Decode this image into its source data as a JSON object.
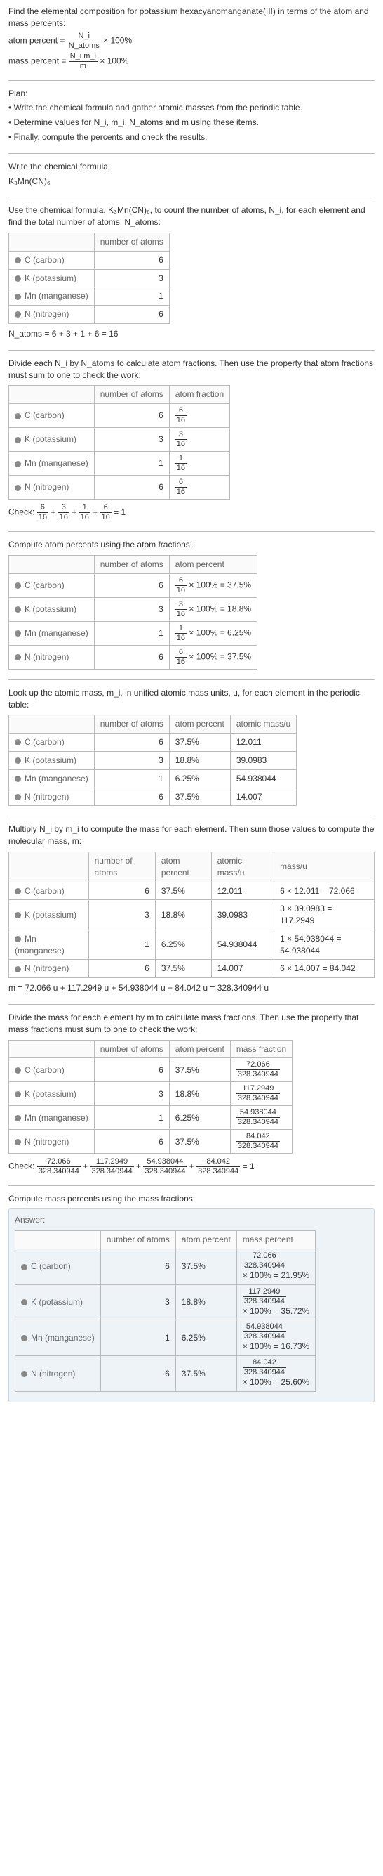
{
  "intro": {
    "line1": "Find the elemental composition for potassium hexacyanomanganate(III) in terms of the atom and mass percents:",
    "atom_percent_label": "atom percent =",
    "atom_percent_frac_num": "N_i",
    "atom_percent_frac_den": "N_atoms",
    "times100": "× 100%",
    "mass_percent_label": "mass percent =",
    "mass_percent_frac_num": "N_i m_i",
    "mass_percent_frac_den": "m"
  },
  "plan": {
    "title": "Plan:",
    "b1": "• Write the chemical formula and gather atomic masses from the periodic table.",
    "b2": "• Determine values for N_i, m_i, N_atoms and m using these items.",
    "b3": "• Finally, compute the percents and check the results."
  },
  "formula_section": {
    "title": "Write the chemical formula:",
    "formula": "K₃Mn(CN)₆"
  },
  "count_section": {
    "text": "Use the chemical formula, K₃Mn(CN)₆, to count the number of atoms, N_i, for each element and find the total number of atoms, N_atoms:",
    "headers": [
      "",
      "number of atoms"
    ],
    "rows": [
      {
        "elem": "C (carbon)",
        "n": "6"
      },
      {
        "elem": "K (potassium)",
        "n": "3"
      },
      {
        "elem": "Mn (manganese)",
        "n": "1"
      },
      {
        "elem": "N (nitrogen)",
        "n": "6"
      }
    ],
    "natoms": "N_atoms = 6 + 3 + 1 + 6 = 16"
  },
  "atomfrac_section": {
    "text": "Divide each N_i by N_atoms to calculate atom fractions. Then use the property that atom fractions must sum to one to check the work:",
    "headers": [
      "",
      "number of atoms",
      "atom fraction"
    ],
    "rows": [
      {
        "elem": "C (carbon)",
        "n": "6",
        "frac_num": "6",
        "frac_den": "16"
      },
      {
        "elem": "K (potassium)",
        "n": "3",
        "frac_num": "3",
        "frac_den": "16"
      },
      {
        "elem": "Mn (manganese)",
        "n": "1",
        "frac_num": "1",
        "frac_den": "16"
      },
      {
        "elem": "N (nitrogen)",
        "n": "6",
        "frac_num": "6",
        "frac_den": "16"
      }
    ],
    "check_label": "Check:",
    "check_expr": "6/16 + 3/16 + 1/16 + 6/16 = 1"
  },
  "atompct_section": {
    "text": "Compute atom percents using the atom fractions:",
    "headers": [
      "",
      "number of atoms",
      "atom percent"
    ],
    "rows": [
      {
        "elem": "C (carbon)",
        "n": "6",
        "frac_num": "6",
        "frac_den": "16",
        "pct": "= 37.5%"
      },
      {
        "elem": "K (potassium)",
        "n": "3",
        "frac_num": "3",
        "frac_den": "16",
        "pct": "= 18.8%"
      },
      {
        "elem": "Mn (manganese)",
        "n": "1",
        "frac_num": "1",
        "frac_den": "16",
        "pct": "= 6.25%"
      },
      {
        "elem": "N (nitrogen)",
        "n": "6",
        "frac_num": "6",
        "frac_den": "16",
        "pct": "= 37.5%"
      }
    ]
  },
  "atomicmass_section": {
    "text": "Look up the atomic mass, m_i, in unified atomic mass units, u, for each element in the periodic table:",
    "headers": [
      "",
      "number of atoms",
      "atom percent",
      "atomic mass/u"
    ],
    "rows": [
      {
        "elem": "C (carbon)",
        "n": "6",
        "pct": "37.5%",
        "mass": "12.011"
      },
      {
        "elem": "K (potassium)",
        "n": "3",
        "pct": "18.8%",
        "mass": "39.0983"
      },
      {
        "elem": "Mn (manganese)",
        "n": "1",
        "pct": "6.25%",
        "mass": "54.938044"
      },
      {
        "elem": "N (nitrogen)",
        "n": "6",
        "pct": "37.5%",
        "mass": "14.007"
      }
    ]
  },
  "masscalc_section": {
    "text": "Multiply N_i by m_i to compute the mass for each element. Then sum those values to compute the molecular mass, m:",
    "headers": [
      "",
      "number of atoms",
      "atom percent",
      "atomic mass/u",
      "mass/u"
    ],
    "rows": [
      {
        "elem": "C (carbon)",
        "n": "6",
        "pct": "37.5%",
        "mass": "12.011",
        "calc": "6 × 12.011 = 72.066"
      },
      {
        "elem": "K (potassium)",
        "n": "3",
        "pct": "18.8%",
        "mass": "39.0983",
        "calc": "3 × 39.0983 = 117.2949"
      },
      {
        "elem": "Mn (manganese)",
        "n": "1",
        "pct": "6.25%",
        "mass": "54.938044",
        "calc": "1 × 54.938044 = 54.938044"
      },
      {
        "elem": "N (nitrogen)",
        "n": "6",
        "pct": "37.5%",
        "mass": "14.007",
        "calc": "6 × 14.007 = 84.042"
      }
    ],
    "msum": "m = 72.066 u + 117.2949 u + 54.938044 u + 84.042 u = 328.340944 u"
  },
  "massfrac_section": {
    "text": "Divide the mass for each element by m to calculate mass fractions. Then use the property that mass fractions must sum to one to check the work:",
    "headers": [
      "",
      "number of atoms",
      "atom percent",
      "mass fraction"
    ],
    "rows": [
      {
        "elem": "C (carbon)",
        "n": "6",
        "pct": "37.5%",
        "frac_num": "72.066",
        "frac_den": "328.340944"
      },
      {
        "elem": "K (potassium)",
        "n": "3",
        "pct": "18.8%",
        "frac_num": "117.2949",
        "frac_den": "328.340944"
      },
      {
        "elem": "Mn (manganese)",
        "n": "1",
        "pct": "6.25%",
        "frac_num": "54.938044",
        "frac_den": "328.340944"
      },
      {
        "elem": "N (nitrogen)",
        "n": "6",
        "pct": "37.5%",
        "frac_num": "84.042",
        "frac_den": "328.340944"
      }
    ],
    "check_label": "Check:",
    "check_parts": [
      {
        "num": "72.066",
        "den": "328.340944"
      },
      {
        "num": "117.2949",
        "den": "328.340944"
      },
      {
        "num": "54.938044",
        "den": "328.340944"
      },
      {
        "num": "84.042",
        "den": "328.340944"
      }
    ],
    "check_eq": "= 1"
  },
  "masspct_section": {
    "text": "Compute mass percents using the mass fractions:",
    "answer_label": "Answer:",
    "headers": [
      "",
      "number of atoms",
      "atom percent",
      "mass percent"
    ],
    "rows": [
      {
        "elem": "C (carbon)",
        "n": "6",
        "pct": "37.5%",
        "frac_num": "72.066",
        "frac_den": "328.340944",
        "res": "× 100% = 21.95%"
      },
      {
        "elem": "K (potassium)",
        "n": "3",
        "pct": "18.8%",
        "frac_num": "117.2949",
        "frac_den": "328.340944",
        "res": "× 100% = 35.72%"
      },
      {
        "elem": "Mn (manganese)",
        "n": "1",
        "pct": "6.25%",
        "frac_num": "54.938044",
        "frac_den": "328.340944",
        "res": "× 100% = 16.73%"
      },
      {
        "elem": "N (nitrogen)",
        "n": "6",
        "pct": "37.5%",
        "frac_num": "84.042",
        "frac_den": "328.340944",
        "res": "× 100% = 25.60%"
      }
    ]
  }
}
